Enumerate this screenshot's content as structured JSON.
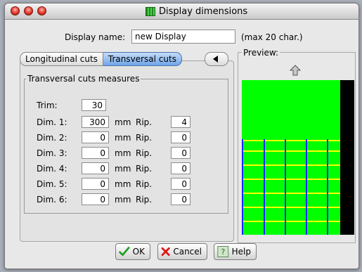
{
  "window": {
    "title": "Display dimensions"
  },
  "display_name": {
    "label": "Display name:",
    "value": "new Display",
    "hint": "(max 20 char.)"
  },
  "tabs": {
    "longitudinal": "Longitudinal cuts",
    "transversal": "Transversal cuts"
  },
  "group_title": "Transversal cuts measures",
  "trim": {
    "label": "Trim:",
    "value": "30"
  },
  "dims": [
    {
      "label": "Dim. 1:",
      "value": "300",
      "unit": "mm",
      "rip_label": "Rip.",
      "rip": "4"
    },
    {
      "label": "Dim. 2:",
      "value": "0",
      "unit": "mm",
      "rip_label": "Rip.",
      "rip": "0"
    },
    {
      "label": "Dim. 3:",
      "value": "0",
      "unit": "mm",
      "rip_label": "Rip.",
      "rip": "0"
    },
    {
      "label": "Dim. 4:",
      "value": "0",
      "unit": "mm",
      "rip_label": "Rip.",
      "rip": "0"
    },
    {
      "label": "Dim. 5:",
      "value": "0",
      "unit": "mm",
      "rip_label": "Rip.",
      "rip": "0"
    },
    {
      "label": "Dim. 6:",
      "value": "0",
      "unit": "mm",
      "rip_label": "Rip.",
      "rip": "0"
    }
  ],
  "preview": {
    "label": "Preview:",
    "fill_color": "#00ff00",
    "cut_color": "#ffff00",
    "line_color": "#1a2cff",
    "side_color": "#000000"
  },
  "buttons": {
    "ok": "OK",
    "cancel": "Cancel",
    "help": "Help"
  },
  "icons": {
    "up": "up-arrow-icon",
    "ok": "checkmark-icon",
    "cancel": "x-icon",
    "help": "question-icon"
  }
}
